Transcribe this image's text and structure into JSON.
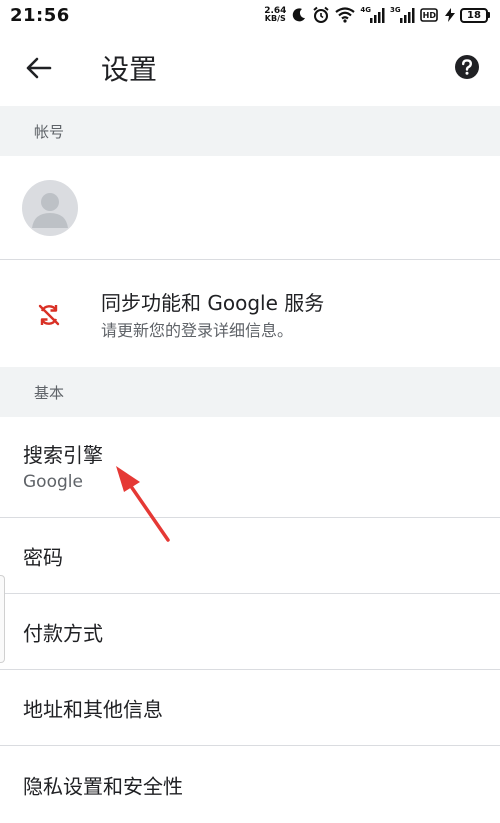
{
  "status_bar": {
    "time": "21:56",
    "net_speed_value": "2.64",
    "net_speed_unit": "KB/S",
    "signal1_label": "4G",
    "signal2_label": "3G",
    "hd_label": "HD",
    "battery_level": "18"
  },
  "header": {
    "title": "设置",
    "back_icon": "arrow-left-icon",
    "help_icon": "help-circle-icon"
  },
  "sections": {
    "account_header": "帐号",
    "basic_header": "基本"
  },
  "sync": {
    "title": "同步功能和 Google 服务",
    "subtitle": "请更新您的登录详细信息。",
    "icon": "sync-error-icon",
    "icon_color": "#d93025"
  },
  "settings": {
    "search_engine_label": "搜索引擎",
    "search_engine_value": "Google",
    "password_label": "密码",
    "payment_label": "付款方式",
    "address_label": "地址和其他信息",
    "privacy_label": "隐私设置和安全性"
  },
  "colors": {
    "section_bg": "#f1f3f4",
    "annotation_arrow": "#e53935"
  }
}
